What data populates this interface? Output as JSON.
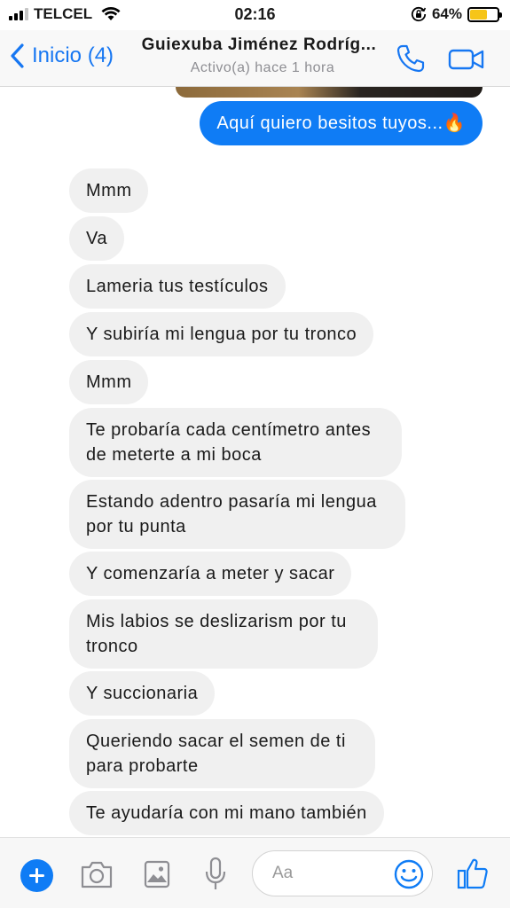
{
  "status_bar": {
    "carrier": "TELCEL",
    "time": "02:16",
    "battery_percent": "64%",
    "battery_level": 0.64,
    "battery_color": "#f6c518",
    "signal_bars": 3,
    "icons": [
      "signal-bars-icon",
      "wifi-icon",
      "rotation-lock-icon",
      "battery-icon"
    ]
  },
  "header": {
    "back_label": "Inicio (4)",
    "contact_name": "Guiexuba Jiménez Rodríg...",
    "contact_status": "Activo(a) hace 1 hora",
    "icons": [
      "chevron-left-icon",
      "chevron-right-icon",
      "phone-icon",
      "video-camera-icon"
    ],
    "accent_color": "#1777f2"
  },
  "messages": [
    {
      "from": "me",
      "text": "Aquí quiero besitos tuyos...🔥"
    },
    {
      "from": "them",
      "text": "Mmm"
    },
    {
      "from": "them",
      "text": "Va"
    },
    {
      "from": "them",
      "text": "Lameria tus testículos"
    },
    {
      "from": "them",
      "text": "Y subiría mi lengua por tu tronco"
    },
    {
      "from": "them",
      "text": "Mmm"
    },
    {
      "from": "them",
      "text": "Te probaría cada centímetro antes de meterte a mi boca"
    },
    {
      "from": "them",
      "text": "Estando adentro pasaría mi lengua por tu punta"
    },
    {
      "from": "them",
      "text": "Y comenzaría a meter y sacar"
    },
    {
      "from": "them",
      "text": "Mis labios se deslizarism por tu tronco"
    },
    {
      "from": "them",
      "text": "Y succionaria"
    },
    {
      "from": "them",
      "text": "Queriendo sacar el semen de ti para probarte"
    },
    {
      "from": "them",
      "text": "Te ayudaría con mi mano también"
    }
  ],
  "colors": {
    "sent_bubble": "#0f7cf5",
    "received_bubble": "#f0f0f0"
  },
  "composer": {
    "placeholder": "Aa",
    "icons": [
      "plus-icon",
      "camera-icon",
      "gallery-icon",
      "microphone-icon",
      "emoji-icon",
      "thumbs-up-icon"
    ]
  }
}
